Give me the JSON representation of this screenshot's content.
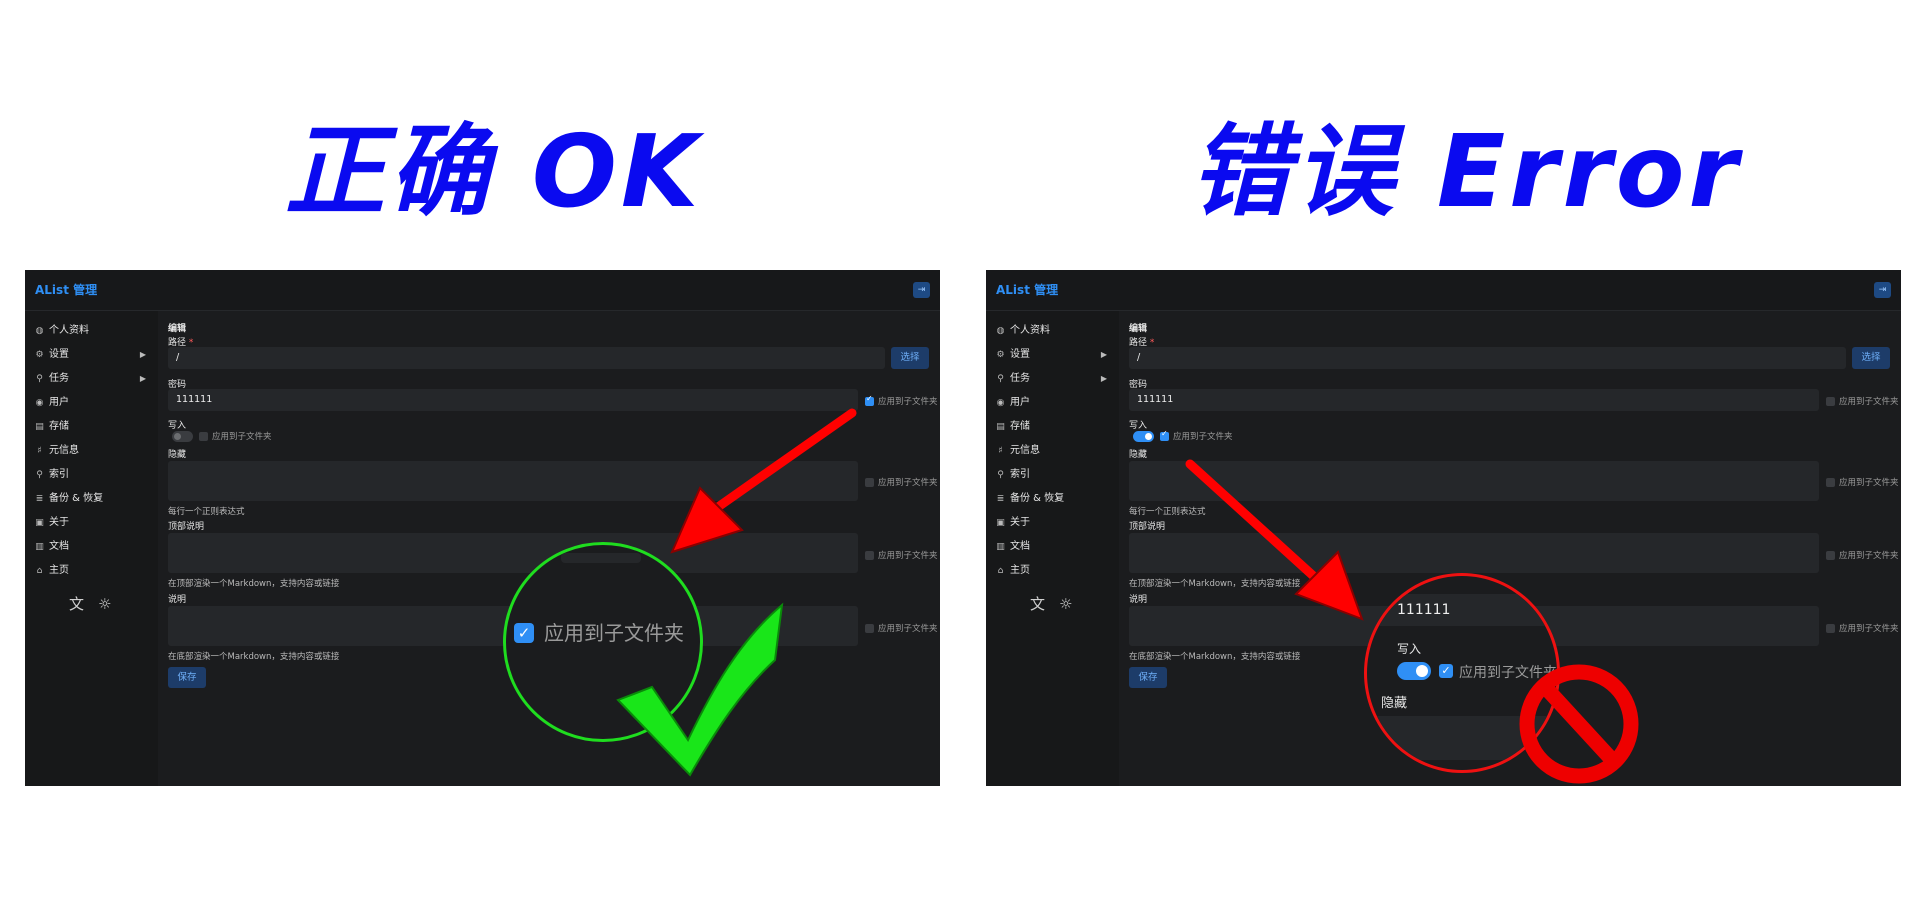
{
  "titles": {
    "ok": "正确 OK",
    "error": "错误 Error"
  },
  "app": {
    "title": "AList 管理",
    "nav": [
      "个人资料",
      "设置",
      "任务",
      "用户",
      "存储",
      "元信息",
      "索引",
      "备份 & 恢复",
      "关于",
      "文档",
      "主页"
    ],
    "icons": [
      "globe-icon",
      "gear-icon",
      "tasks-icon",
      "user-icon",
      "storage-icon",
      "meta-icon",
      "search-icon",
      "database-icon",
      "about-icon",
      "book-icon",
      "home-icon"
    ]
  },
  "form": {
    "heading": "编辑",
    "path_label": "路径",
    "path_required": "*",
    "path_value": "/",
    "select_button": "选择",
    "password_label": "密码",
    "password_value": "111111",
    "write_label": "写入",
    "hide_label": "隐藏",
    "hide_hint": "每行一个正则表达式",
    "readme_label": "顶部说明",
    "readme_hint": "在顶部渲染一个Markdown，支持内容或链接",
    "header_label": "说明",
    "header_hint": "在底部渲染一个Markdown，支持内容或链接",
    "apply_sub": "应用到子文件夹",
    "save_button": "保存"
  },
  "panels": {
    "ok": {
      "password_apply_sub": true,
      "write_on": false,
      "write_apply_sub": false
    },
    "error": {
      "password_apply_sub": false,
      "write_on": true,
      "write_apply_sub": true
    }
  },
  "zoom": {
    "ok": {
      "apply_sub": "应用到子文件夹"
    },
    "error": {
      "password_value": "111111",
      "write_label": "写入",
      "apply_sub": "应用到子文件夹",
      "hide_label": "隐藏"
    }
  },
  "colors": {
    "title_blue": "#0a0af0",
    "accent": "#2f8ff5",
    "ok_green": "#1fdd1f",
    "error_red": "#ee1111",
    "panel_bg": "#1b1c1e"
  }
}
